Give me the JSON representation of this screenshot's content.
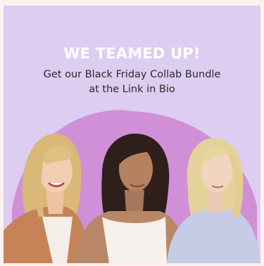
{
  "promo": {
    "headline": "WE TEAMED UP!",
    "subline_1": "Get our Black Friday Collab Bundle",
    "subline_2": "at the Link in Bio"
  },
  "colors": {
    "outer": "#fdf1ee",
    "panel": "#dccdf1",
    "arch": "#d08fd7",
    "headline": "#ffffff",
    "subtext": "#2a2a2a"
  }
}
